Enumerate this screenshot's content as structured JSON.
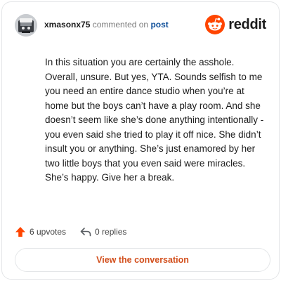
{
  "header": {
    "username": "xmasonx75",
    "commented_text": "commented on",
    "post_link": "post",
    "brand_text": "reddit",
    "brand_color": "#ff4500"
  },
  "comment": {
    "text": "In this situation you are certainly the asshole. Overall, unsure. But yes, YTA. Sounds selfish to me you need an entire dance studio when you’re at home but the boys can’t have a play room. And she doesn’t seem like she’s done anything intentionally - you even said she tried to play it off nice. She didn’t insult you or anything. She’s just enamored by her two little boys that you even said were miracles. She’s happy. Give her a break."
  },
  "actions": {
    "upvotes_label": "6 upvotes",
    "replies_label": "0 replies",
    "upvote_icon": "upvote-arrow-icon",
    "reply_icon": "reply-arrow-icon"
  },
  "footer": {
    "view_button_label": "View the conversation",
    "accent_color": "#d24e1b"
  }
}
